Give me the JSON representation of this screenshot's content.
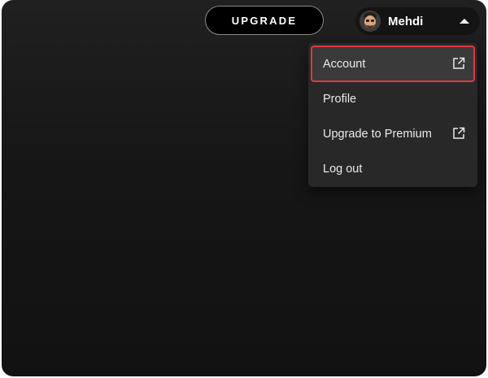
{
  "header": {
    "upgrade_label": "UPGRADE",
    "user": {
      "name": "Mehdi",
      "avatar_icon": "avatar-memoji-icon",
      "chevron_icon": "chevron-up-icon"
    }
  },
  "menu": {
    "items": [
      {
        "label": "Account",
        "external": true,
        "highlighted": true
      },
      {
        "label": "Profile",
        "external": false
      },
      {
        "label": "Upgrade to Premium",
        "external": true
      },
      {
        "label": "Log out",
        "external": false
      }
    ],
    "external_icon": "external-link-icon"
  },
  "colors": {
    "background": "#121212",
    "menu_background": "#282828",
    "highlight_outline": "#e0383e",
    "text": "#ffffff"
  }
}
